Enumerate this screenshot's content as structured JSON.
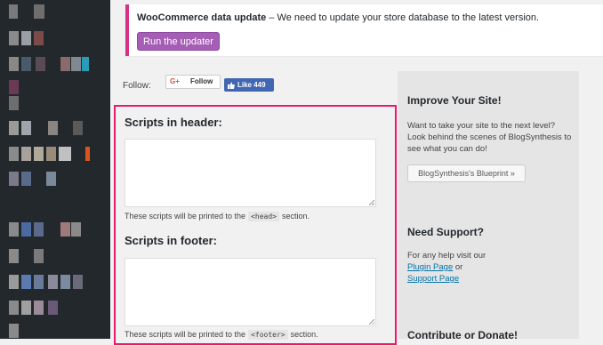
{
  "notice": {
    "title": "WooCommerce data update",
    "message": " – We need to update your store database to the latest version.",
    "button_label": "Run the updater"
  },
  "social": {
    "follow_label": "Follow:",
    "gplus_icon": "G+",
    "gplus_label": "Follow",
    "fb_label": "Like 449"
  },
  "scripts": {
    "header": {
      "title": "Scripts in header:",
      "hint_before": "These scripts will be printed to the",
      "hint_code": "<head>",
      "hint_after": "section.",
      "value": ""
    },
    "footer": {
      "title": "Scripts in footer:",
      "hint_before": "These scripts will be printed to the",
      "hint_code": "<footer>",
      "hint_after": "section.",
      "value": ""
    }
  },
  "panel": {
    "improve_title": "Improve Your Site!",
    "improve_text": "Want to take your site to the next level? Look behind the scenes of BlogSynthesis to see what you can do!",
    "blueprint_button": "BlogSynthesis's Blueprint »",
    "support_title": "Need Support?",
    "support_text": "For any help visit our",
    "plugin_link": "Plugin Page",
    "or_text": " or",
    "support_link": "Support Page",
    "contribute_title": "Contribute or Donate!"
  },
  "colors": {
    "highlight_border": "#e9196e",
    "notice_border": "#d63384",
    "updater_button": "#a55db5",
    "sidebar_bg": "#23282d"
  }
}
